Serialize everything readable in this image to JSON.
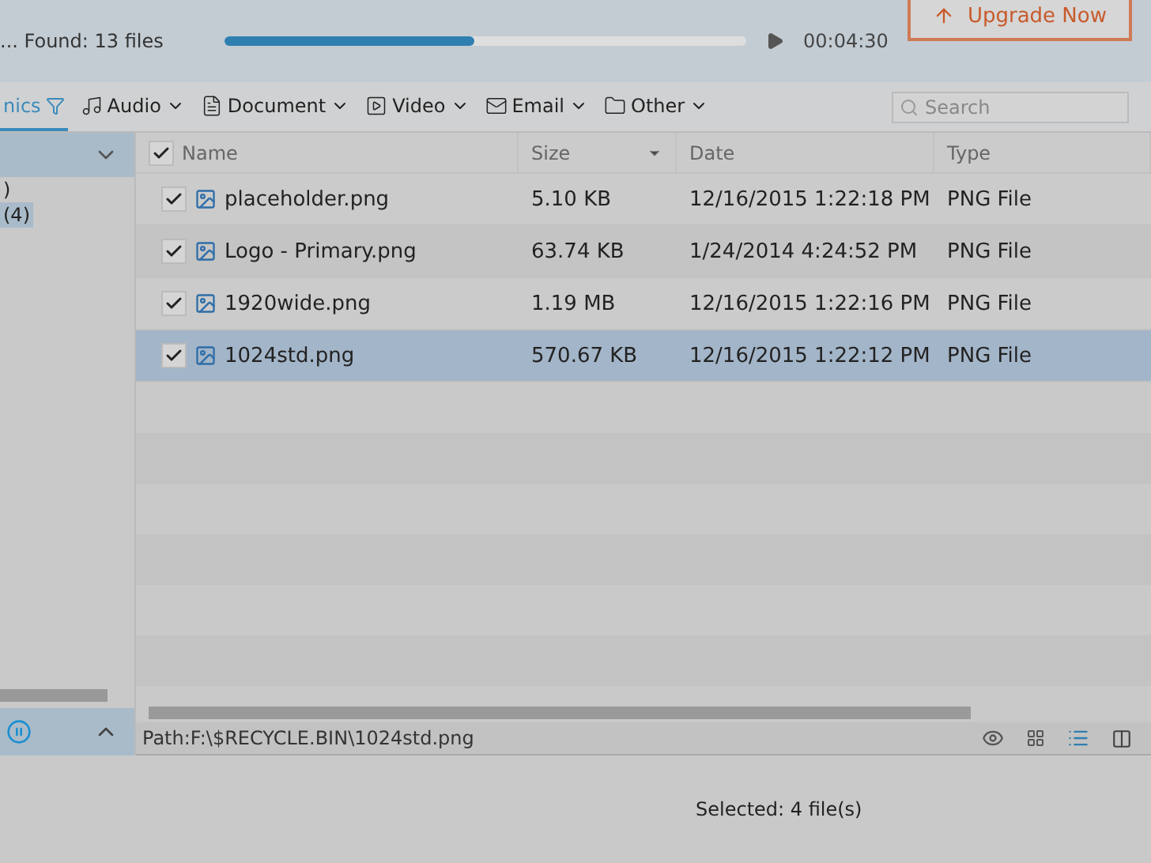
{
  "scan": {
    "status": "... Found: 13 files",
    "progress": {
      "level": 0.48
    },
    "elapsed": "00:04:30",
    "upgrade_button": "Upgrade Now"
  },
  "category_tabs": [
    {
      "label": "nics",
      "kind": "filter",
      "selected": true
    },
    {
      "label": "Audio",
      "kind": "audio",
      "selected": false
    },
    {
      "label": "Document",
      "kind": "document",
      "selected": false
    },
    {
      "label": "Video",
      "kind": "video",
      "selected": false
    },
    {
      "label": "Email",
      "kind": "email",
      "selected": false
    },
    {
      "label": "Other",
      "kind": "folder",
      "selected": false
    }
  ],
  "search": {
    "placeholder": "Search"
  },
  "sidebar": {
    "items": [
      {
        "label": ")",
        "selected": false
      },
      {
        "label": "(4)",
        "selected": true
      }
    ]
  },
  "table": {
    "columns": [
      "Name",
      "Size",
      "Date",
      "Type"
    ],
    "all_checked": true,
    "rows": [
      {
        "name": "placeholder.png",
        "size": "5.10 KB",
        "date": "12/16/2015 1:22:18 PM",
        "type": "PNG File",
        "checked": true,
        "selected": false
      },
      {
        "name": "Logo - Primary.png",
        "size": "63.74 KB",
        "date": "1/24/2014 4:24:52 PM",
        "type": "PNG File",
        "checked": true,
        "selected": false
      },
      {
        "name": "1920wide.png",
        "size": "1.19 MB",
        "date": "12/16/2015 1:22:16 PM",
        "type": "PNG File",
        "checked": true,
        "selected": false
      },
      {
        "name": "1024std.png",
        "size": "570.67 KB",
        "date": "12/16/2015 1:22:12 PM",
        "type": "PNG File",
        "checked": true,
        "selected": true
      }
    ]
  },
  "path_bar": "Path:F:\\$RECYCLE.BIN\\1024std.png",
  "footer": {
    "selected_count": "Selected: 4 file(s)"
  }
}
